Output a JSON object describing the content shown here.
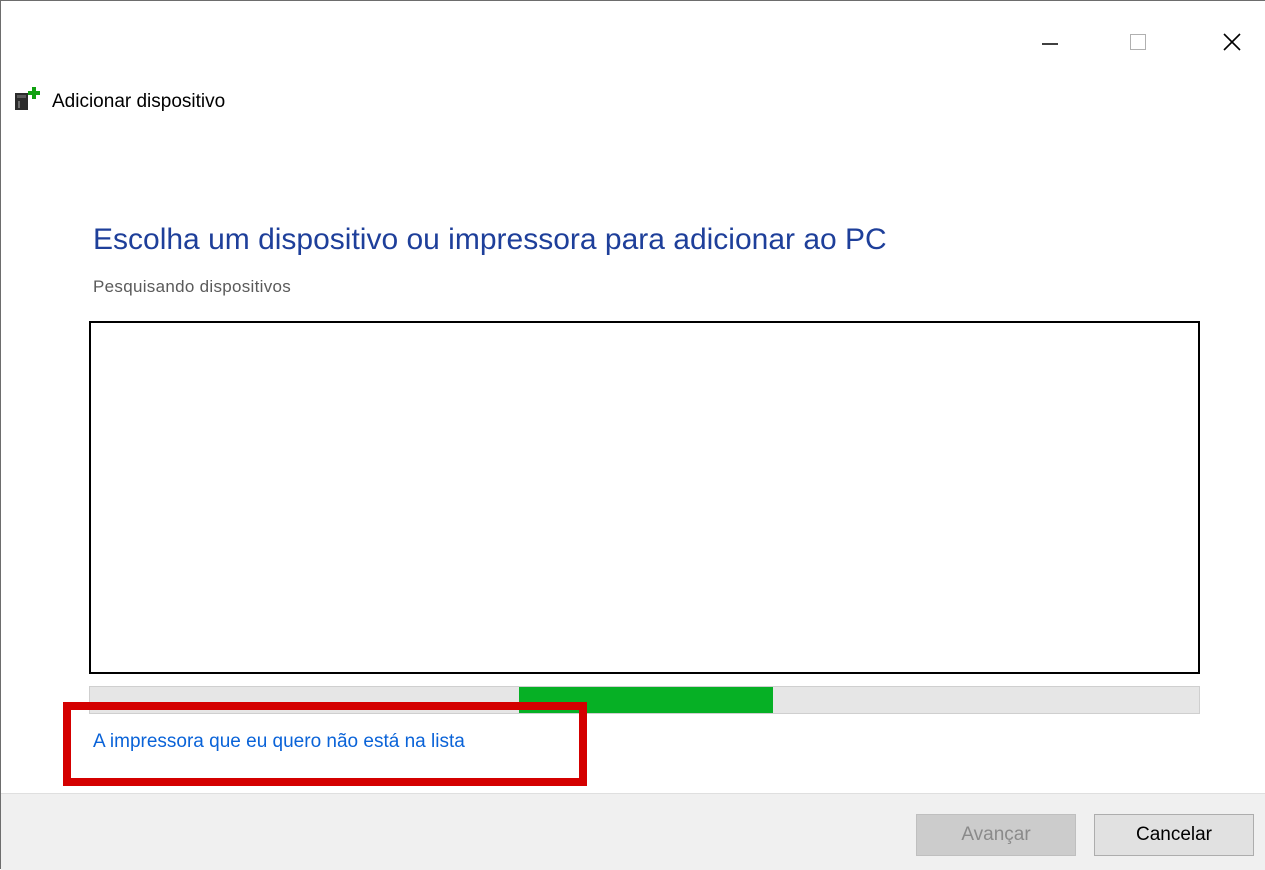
{
  "window": {
    "title": "Adicionar dispositivo",
    "icon": "add-device-icon",
    "controls": [
      "minimize-icon",
      "maximize-icon",
      "close-icon"
    ]
  },
  "main": {
    "heading": "Escolha um dispositivo ou impressora para adicionar ao PC",
    "status": "Pesquisando dispositivos",
    "devices": [],
    "progress": {
      "start_fraction": 0.387,
      "end_fraction": 0.616,
      "state": "indeterminate",
      "color": "#06b025"
    },
    "missing_printer_link": "A impressora que eu quero não está na lista",
    "highlight_color": "#d40000"
  },
  "footer": {
    "next_label": "Avançar",
    "next_enabled": false,
    "cancel_label": "Cancelar"
  },
  "colors": {
    "heading": "#1e3f9a",
    "link": "#0a63d8"
  }
}
